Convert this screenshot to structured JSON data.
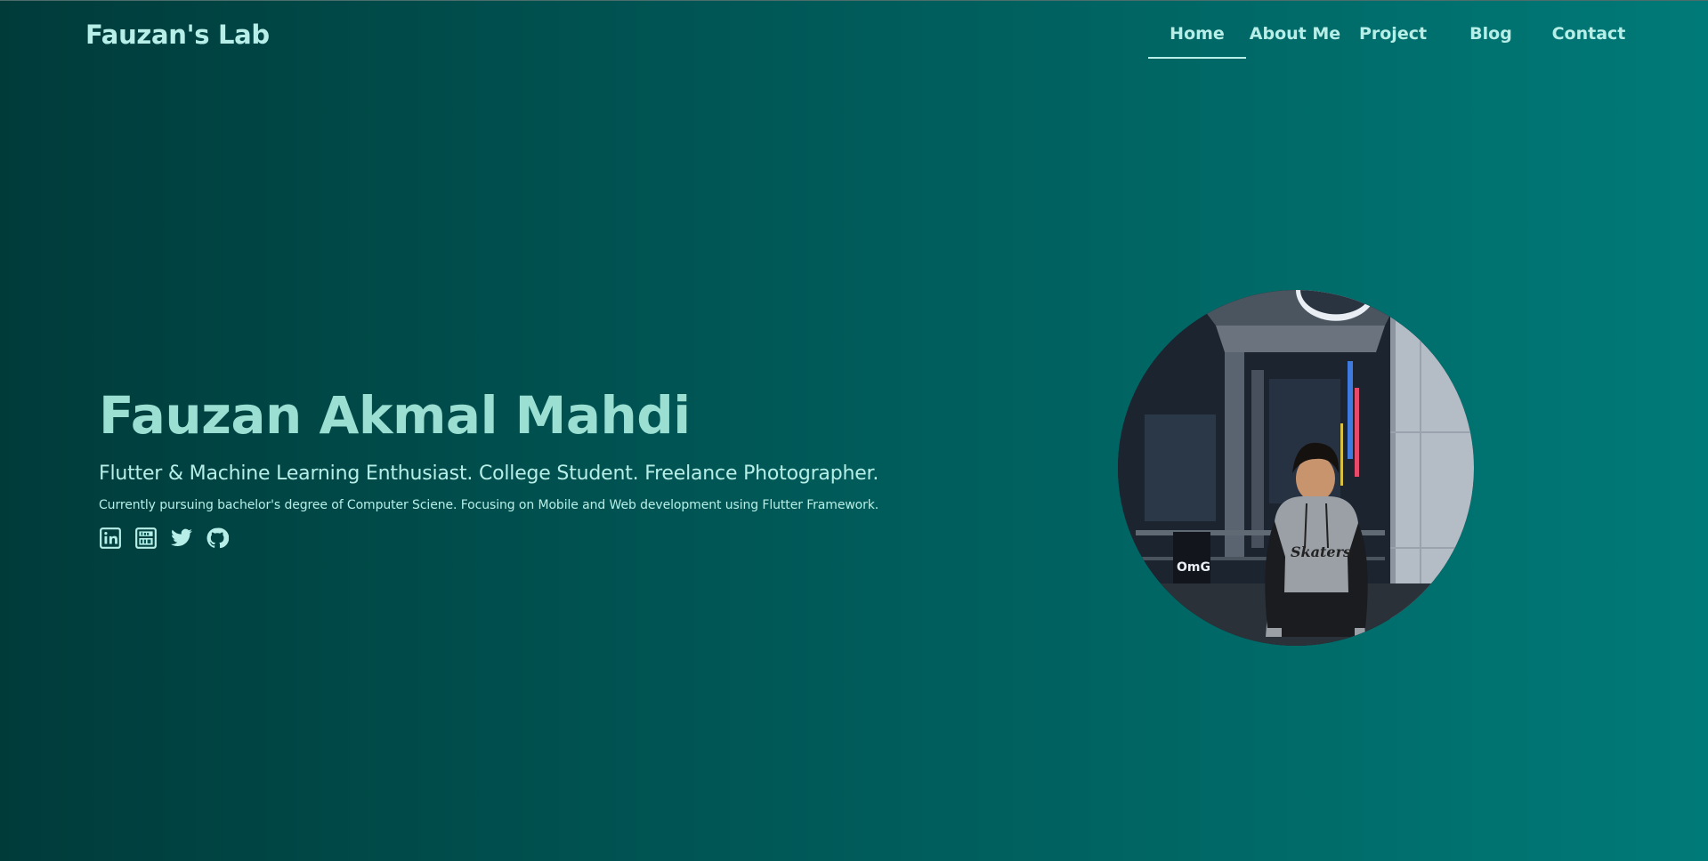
{
  "header": {
    "brand": "Fauzan's Lab",
    "nav": [
      {
        "label": "Home",
        "active": true
      },
      {
        "label": "About Me",
        "active": false
      },
      {
        "label": "Project",
        "active": false
      },
      {
        "label": "Blog",
        "active": false
      },
      {
        "label": "Contact",
        "active": false
      }
    ]
  },
  "hero": {
    "name": "Fauzan Akmal Mahdi",
    "tagline": "Flutter & Machine Learning Enthusiast. College Student. Freelance Photographer.",
    "description": "Currently pursuing bachelor's degree of Computer Sciene. Focusing on Mobile and Web development using Flutter Framework.",
    "socials": [
      {
        "icon": "linkedin-icon"
      },
      {
        "icon": "youtube-icon"
      },
      {
        "icon": "twitter-icon"
      },
      {
        "icon": "github-icon"
      }
    ],
    "photo": {
      "icon": "profile-photo"
    }
  },
  "colors": {
    "accent": "#b7efe8",
    "name": "#9bdfd3",
    "bg_start": "#003b3a",
    "bg_end": "#007a78"
  }
}
